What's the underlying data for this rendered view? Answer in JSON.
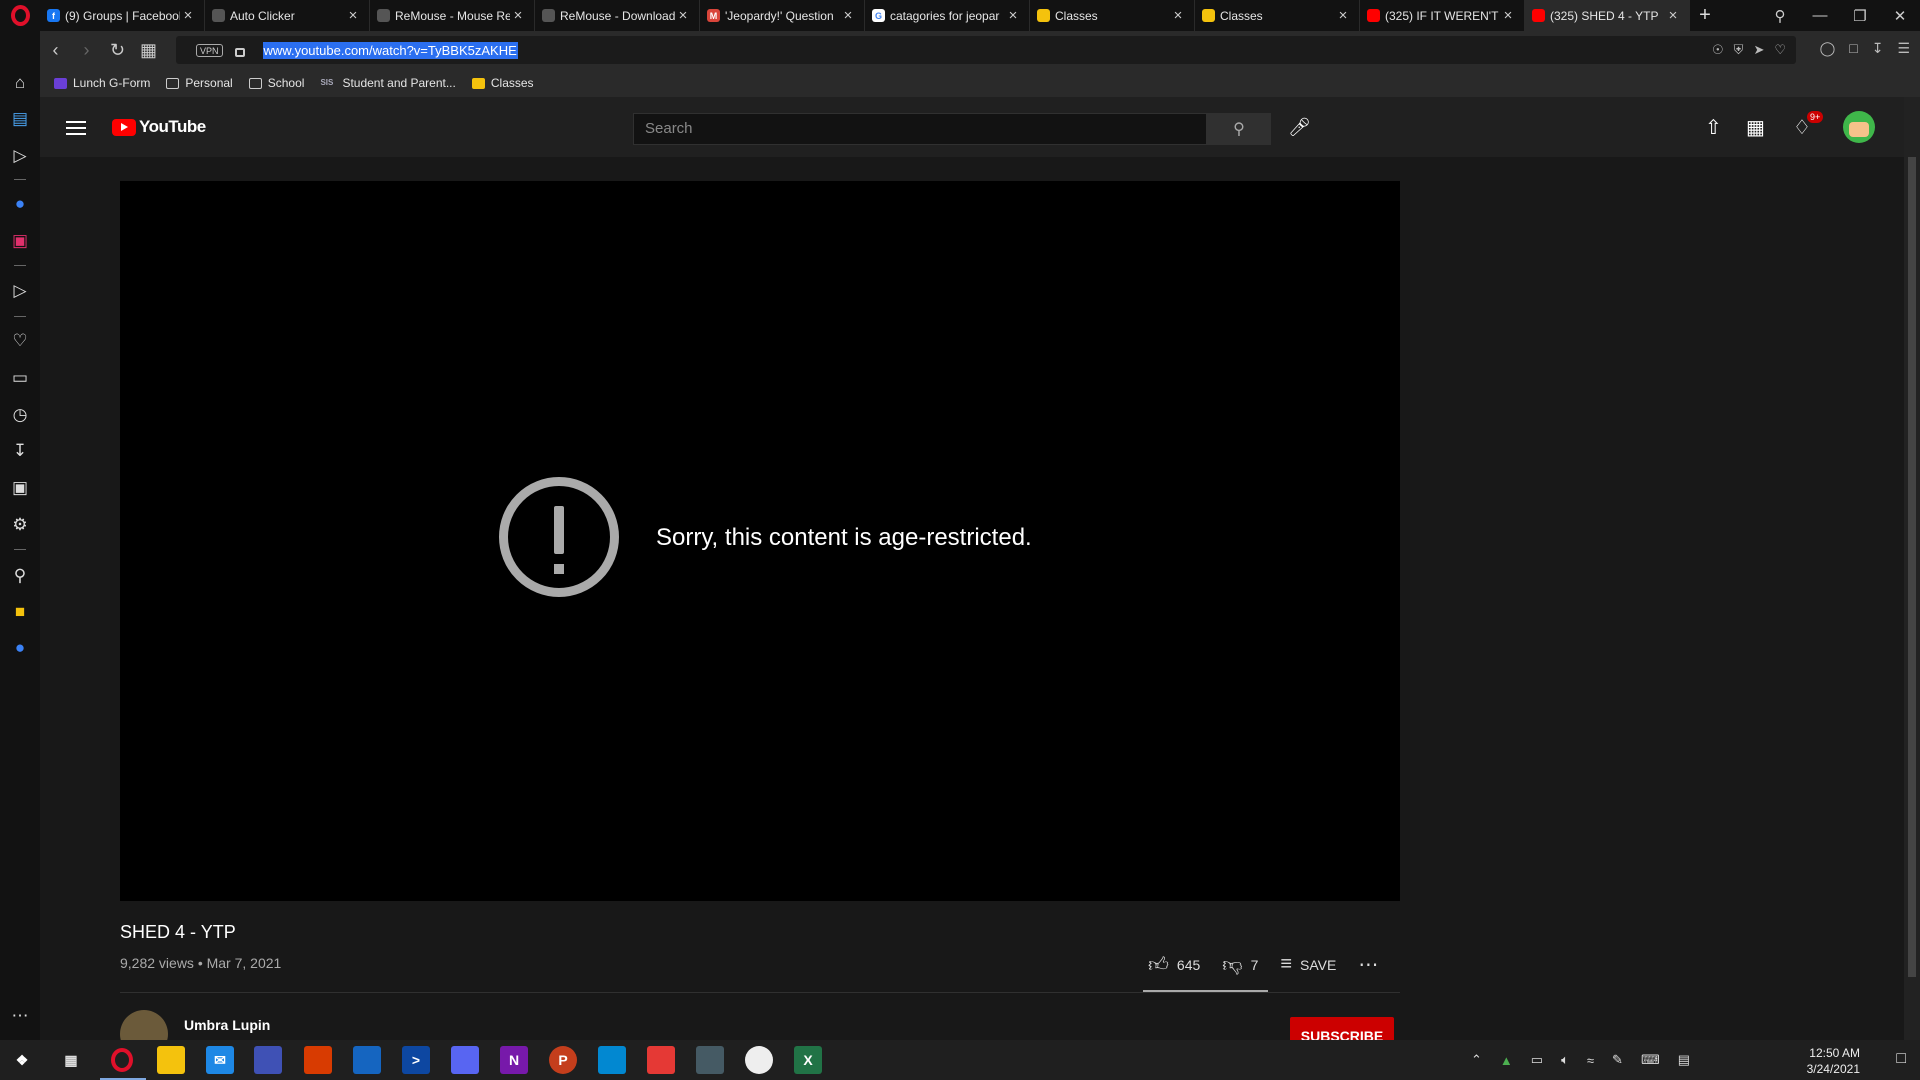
{
  "browser": {
    "tabs": [
      {
        "label": "(9) Groups | Facebook",
        "favicon": "facebook-icon",
        "color": "#1877f2",
        "glyph": "f"
      },
      {
        "label": "Auto Clicker",
        "favicon": "mouse-icon",
        "color": "#555555",
        "glyph": ""
      },
      {
        "label": "ReMouse - Mouse Re",
        "favicon": "mouse-icon",
        "color": "#555555",
        "glyph": ""
      },
      {
        "label": "ReMouse - Download",
        "favicon": "mouse-icon",
        "color": "#555555",
        "glyph": ""
      },
      {
        "label": "'Jeopardy!' Question",
        "favicon": "jeopardy-icon",
        "color": "#d9453a",
        "glyph": "M"
      },
      {
        "label": "catagories for jeopar",
        "favicon": "google-icon",
        "color": "#ffffff",
        "glyph": "G"
      },
      {
        "label": "Classes",
        "favicon": "classroom-icon",
        "color": "#f4c20d",
        "glyph": ""
      },
      {
        "label": "Classes",
        "favicon": "classroom-icon",
        "color": "#f4c20d",
        "glyph": ""
      },
      {
        "label": "(325) IF IT WEREN'T",
        "favicon": "youtube-icon",
        "color": "#ff0000",
        "glyph": ""
      },
      {
        "label": "(325) SHED 4 - YTP",
        "favicon": "youtube-icon",
        "color": "#ff0000",
        "glyph": "",
        "active": true
      }
    ],
    "url": "www.youtube.com/watch?v=TyBBK5zAKHE",
    "vpn_label": "VPN",
    "bookmarks": [
      {
        "label": "Lunch G-Form",
        "icon": "forms-icon"
      },
      {
        "label": "Personal",
        "icon": "folder-icon"
      },
      {
        "label": "School",
        "icon": "folder-icon"
      },
      {
        "label": "Student and Parent...",
        "icon": "sis-icon",
        "glyph": "SIS"
      },
      {
        "label": "Classes",
        "icon": "classroom-icon"
      }
    ]
  },
  "youtube": {
    "logo_text": "YouTube",
    "search_placeholder": "Search",
    "notification_badge": "9+",
    "error_message": "Sorry, this content is age-restricted.",
    "video_title": "SHED 4 - YTP",
    "video_meta": "9,282 views • Mar 7, 2021",
    "likes": "645",
    "dislikes": "7",
    "save_label": "SAVE",
    "channel_name": "Umbra Lupin",
    "subscribe_label": "SUBSCRIBE"
  },
  "taskbar": {
    "time": "12:50 AM",
    "date": "3/24/2021"
  }
}
